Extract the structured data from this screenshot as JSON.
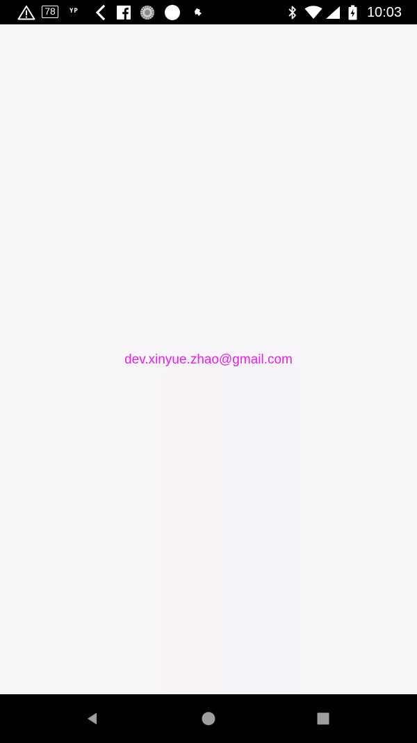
{
  "status_bar": {
    "time": "10:03",
    "notification_count": "78",
    "yp_label": "YP",
    "icons": [
      "warning-icon",
      "notification-count-icon",
      "yp-app-icon",
      "back-arrow-icon",
      "facebook-icon",
      "dotted-circle-icon",
      "white-circle-icon",
      "small-app-icon",
      "bluetooth-icon",
      "wifi-icon",
      "cell-signal-icon",
      "battery-charging-icon"
    ]
  },
  "main": {
    "email": "dev.xinyue.zhao@gmail.com"
  },
  "navigation_bar": {
    "buttons": [
      "back-button",
      "home-button",
      "recents-button"
    ]
  },
  "colors": {
    "background": "#f7f5f8",
    "email_text": "#e620e6",
    "bars": "#000000"
  }
}
